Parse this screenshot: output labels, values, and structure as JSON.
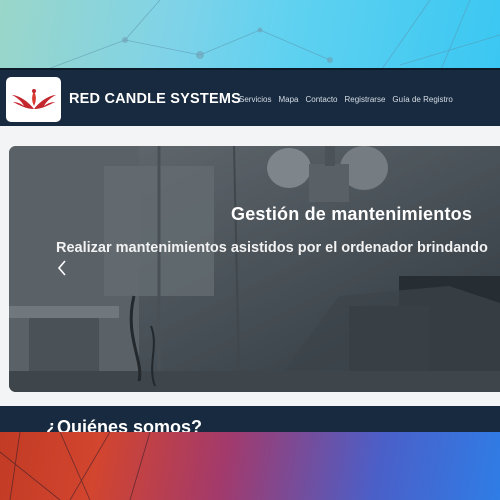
{
  "brand": {
    "name": "RED CANDLE SYSTEMS",
    "logo_icon": "phoenix-logo-icon"
  },
  "nav": {
    "links": [
      "Servicios",
      "Mapa",
      "Contacto",
      "Registrarse",
      "Guía de Registro"
    ]
  },
  "carousel": {
    "title": "Gestión de mantenimientos",
    "text": "Realizar mantenimientos asistidos por el ordenador brindando",
    "prev_icon": "chevron-left-icon"
  },
  "about": {
    "title": "¿Quiénes somos?"
  },
  "colors": {
    "navbar": "#172a3f",
    "accent_red": "#c4262e",
    "page_bg": "#f3f4f6"
  }
}
